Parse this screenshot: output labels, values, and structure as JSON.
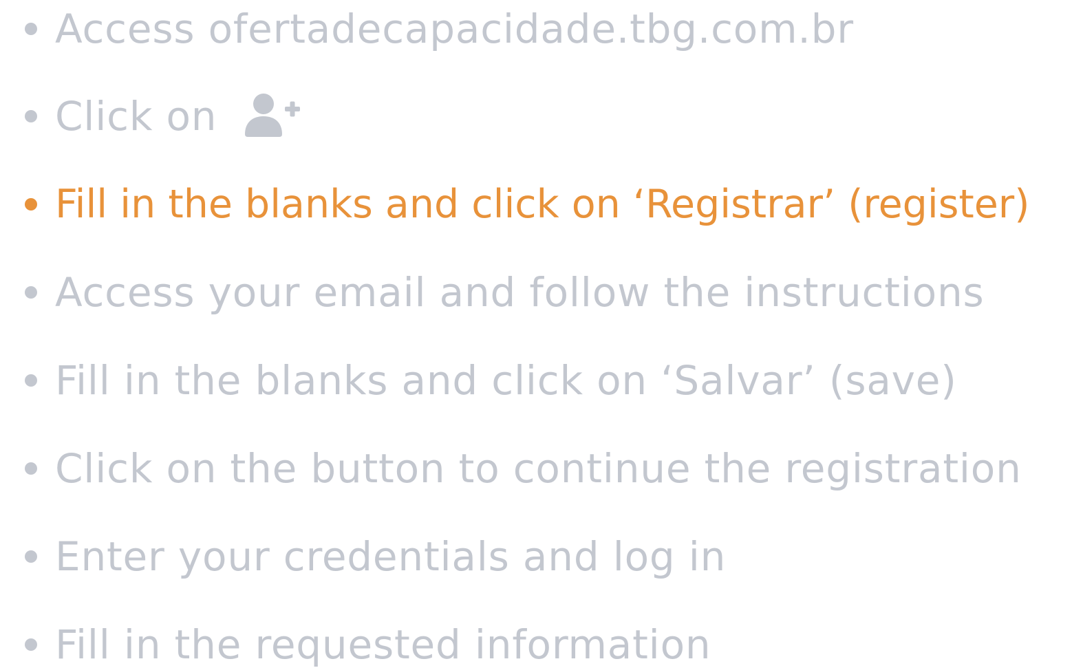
{
  "colors": {
    "muted": "#c3c7cf",
    "accent": "#e8923a"
  },
  "steps": [
    {
      "label": "Access ofertadecapacidade.tbg.com.br",
      "active": false
    },
    {
      "label": "Click on",
      "active": false,
      "icon": "user-plus-icon"
    },
    {
      "label": "Fill in the blanks and click on ‘Registrar’ (register)",
      "active": true
    },
    {
      "label": "Access your email and follow the instructions",
      "active": false
    },
    {
      "label": "Fill in the blanks and click on ‘Salvar’ (save)",
      "active": false
    },
    {
      "label": "Click on the button to continue the registration",
      "active": false
    },
    {
      "label": "Enter your credentials and log in",
      "active": false
    },
    {
      "label": "Fill in the requested information",
      "active": false
    }
  ]
}
